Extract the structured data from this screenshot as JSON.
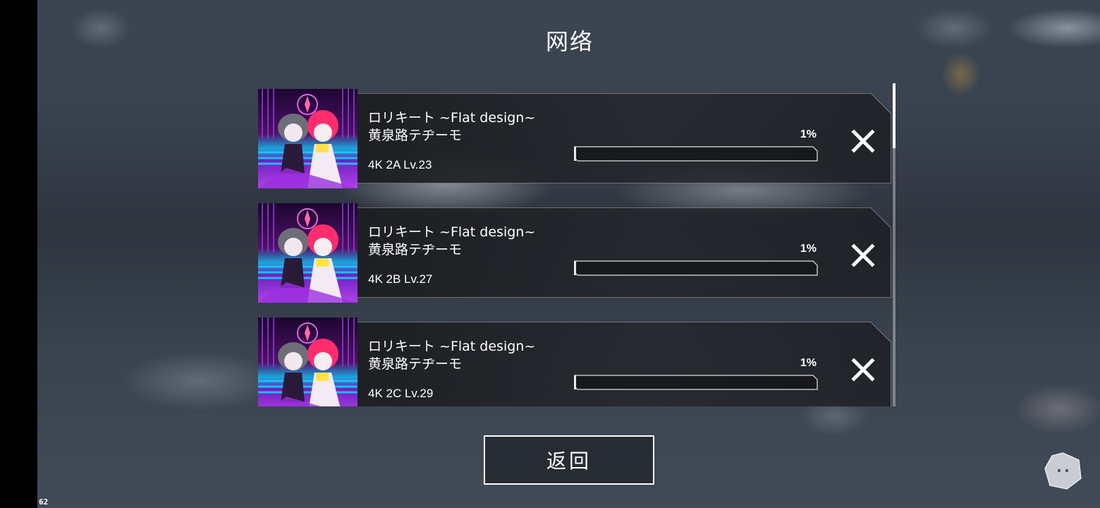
{
  "header": {
    "title": "网络"
  },
  "downloads": [
    {
      "title": "ロリキート ~Flat design~",
      "artist": "黄泉路テヂーモ",
      "meta": "4K 2A  Lv.23",
      "percent_label": "1%",
      "progress": 0.01
    },
    {
      "title": "ロリキート ~Flat design~",
      "artist": "黄泉路テヂーモ",
      "meta": "4K 2B  Lv.27",
      "percent_label": "1%",
      "progress": 0.01
    },
    {
      "title": "ロリキート ~Flat design~",
      "artist": "黄泉路テヂーモ",
      "meta": "4K 2C  Lv.29",
      "percent_label": "1%",
      "progress": 0.01
    }
  ],
  "footer": {
    "back_label": "返回"
  },
  "overlay": {
    "fps": "62"
  },
  "icons": {
    "cancel": "close-icon",
    "floating": "chat-bubble-icon"
  },
  "colors": {
    "text": "#ffffff",
    "panel": "#1e2024",
    "accent_pink": "#ff2d6e",
    "accent_purple": "#8b2fd6",
    "accent_cyan": "#1ba3d6"
  }
}
